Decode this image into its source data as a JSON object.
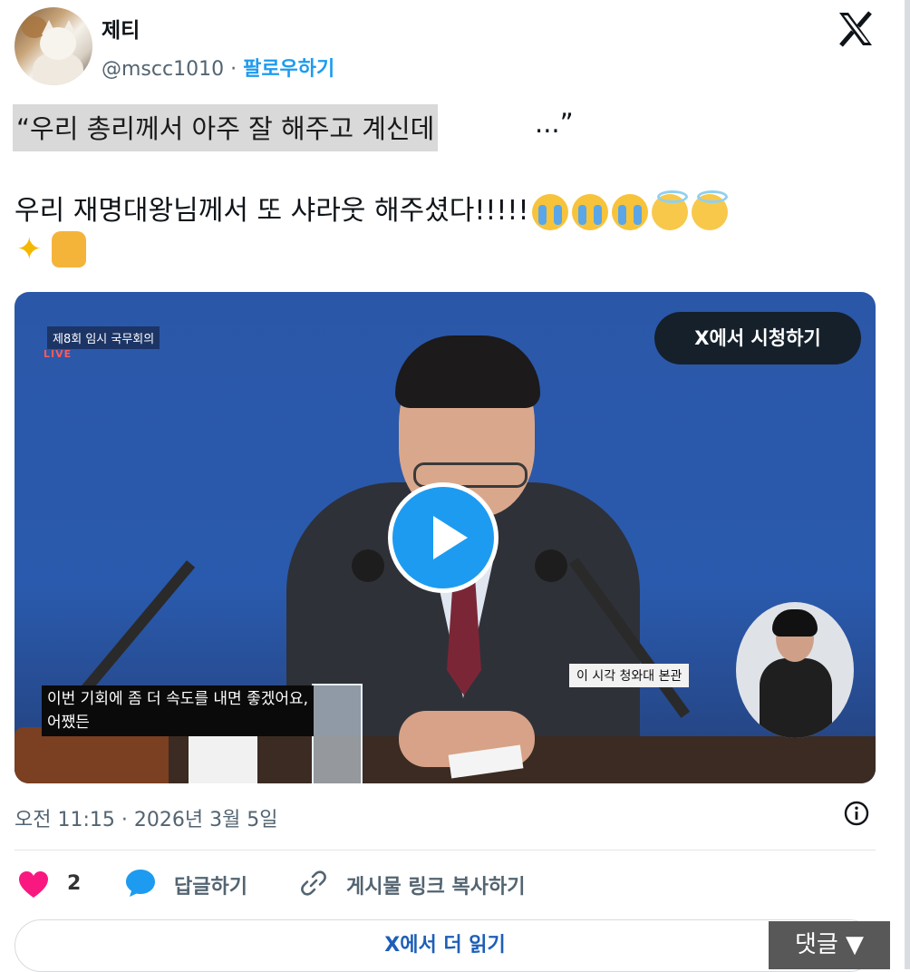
{
  "author": {
    "name": "제티",
    "handle": "@mscc1010",
    "separator": "·",
    "follow_label": "팔로우하기"
  },
  "tweet": {
    "quote_highlighted": "“우리 총리께서 아주 잘 해주고 계신데",
    "quote_end": "...”",
    "line2_text": "우리 재명대왕님께서 또 샤라웃 해주셨다!!!!!",
    "emoji_names": [
      "loudly-crying-face",
      "loudly-crying-face",
      "loudly-crying-face",
      "smiling-face-with-halo",
      "smiling-face-with-halo",
      "sparkles",
      "thumbs-up"
    ]
  },
  "video": {
    "broadcast_title": "제8회 임시 국무회의",
    "live_label": "LIVE",
    "watch_on_x": "X에서 시청하기",
    "caption_lines": [
      "이번 기회에 좀 더 속도를 내면 좋겠어요,",
      "어쨌든"
    ],
    "location_label": "이 시각 청와대 본관"
  },
  "meta": {
    "timestamp": "오전 11:15 · 2026년 3월 5일"
  },
  "actions": {
    "like_count": "2",
    "reply_label": "답글하기",
    "copy_link_label": "게시물 링크 복사하기"
  },
  "read_more_label": "X에서 더 읽기",
  "comment_overlay": "댓글 ▼",
  "colors": {
    "accent_blue": "#1d9bf0",
    "heart_red": "#f91880",
    "text_gray": "#536471"
  }
}
